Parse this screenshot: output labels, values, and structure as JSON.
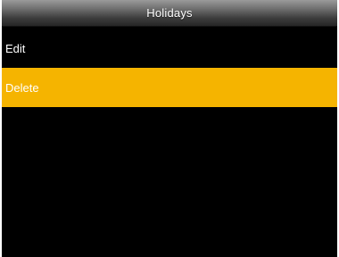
{
  "title_bar": {
    "title": "Holidays"
  },
  "menu": {
    "items": [
      {
        "label": "Edit",
        "selected": false
      },
      {
        "label": "Delete",
        "selected": true
      }
    ]
  },
  "colors": {
    "background": "#000000",
    "selected_row": "#f5b400",
    "text": "#ffffff"
  }
}
